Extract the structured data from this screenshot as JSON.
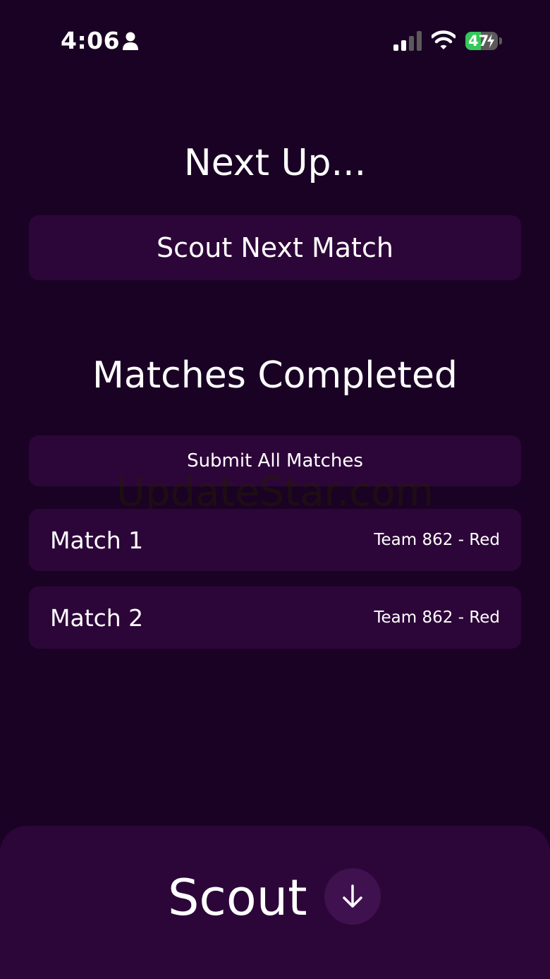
{
  "status_bar": {
    "time": "4:06",
    "battery_level": "47",
    "battery_fraction": 0.47,
    "battery_color": "#34c759",
    "signal_bars_active": 2,
    "signal_bars_total": 4
  },
  "next_up": {
    "heading": "Next Up...",
    "scout_next_label": "Scout Next Match"
  },
  "completed": {
    "heading": "Matches Completed",
    "submit_all_label": "Submit All Matches",
    "matches": [
      {
        "name": "Match 1",
        "team": "Team 862 - Red"
      },
      {
        "name": "Match 2",
        "team": "Team 862 - Red"
      }
    ]
  },
  "watermark": "UpdateStar.com",
  "bottom": {
    "label": "Scout",
    "toggle_icon": "arrow-down-icon"
  },
  "colors": {
    "background": "#1a0224",
    "panel": "#2d0639",
    "accent": "#40114f"
  }
}
